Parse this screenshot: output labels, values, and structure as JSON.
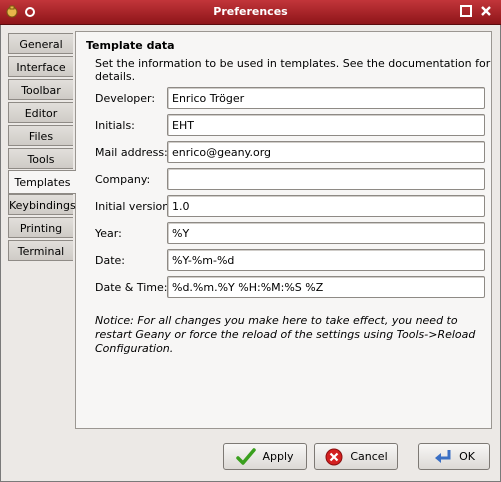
{
  "window": {
    "title": "Preferences"
  },
  "tabs": [
    {
      "label": "General"
    },
    {
      "label": "Interface"
    },
    {
      "label": "Toolbar"
    },
    {
      "label": "Editor"
    },
    {
      "label": "Files"
    },
    {
      "label": "Tools"
    },
    {
      "label": "Templates",
      "active": true
    },
    {
      "label": "Keybindings"
    },
    {
      "label": "Printing"
    },
    {
      "label": "Terminal"
    }
  ],
  "template": {
    "title": "Template data",
    "description": "Set the information to be used in templates. See the documentation for details.",
    "fields": {
      "developer": {
        "label": "Developer:",
        "value": "Enrico Tröger"
      },
      "initials": {
        "label": "Initials:",
        "value": "EHT"
      },
      "mail": {
        "label": "Mail address:",
        "value": "enrico@geany.org"
      },
      "company": {
        "label": "Company:",
        "value": ""
      },
      "version": {
        "label": "Initial version:",
        "value": "1.0"
      },
      "year": {
        "label": "Year:",
        "value": "%Y"
      },
      "date": {
        "label": "Date:",
        "value": "%Y-%m-%d"
      },
      "datetime": {
        "label": "Date & Time:",
        "value": "%d.%m.%Y %H:%M:%S %Z"
      }
    },
    "notice": "Notice: For all changes you make here to take effect, you need to restart Geany or force the reload of the settings using Tools->Reload Configuration."
  },
  "buttons": {
    "apply": "Apply",
    "cancel": "Cancel",
    "ok": "OK"
  },
  "colors": {
    "titlebar": "#b02a2f",
    "apply_icon": "#3aa01e",
    "cancel_icon": "#d32020",
    "ok_icon": "#3a6fc4"
  }
}
